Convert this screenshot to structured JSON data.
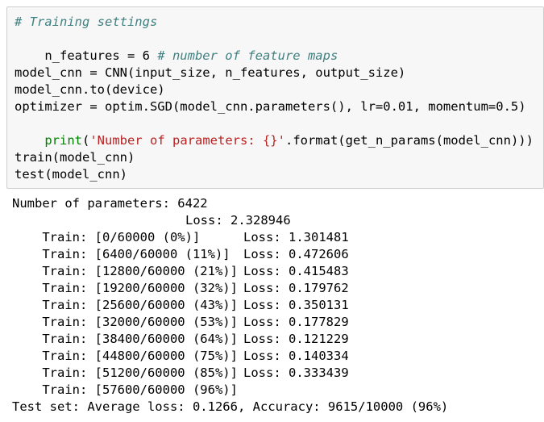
{
  "code": {
    "line1": "# Training settings",
    "line2a": "n_features = 6 ",
    "line2b": "# number of feature maps",
    "line4": "model_cnn = CNN(input_size, n_features, output_size)",
    "line5": "model_cnn.to(device)",
    "line6": "optimizer = optim.SGD(model_cnn.parameters(), lr=0.01, momentum=0.5)",
    "line7a": "print",
    "line7b": "(",
    "line7c": "'Number of parameters: {}'",
    "line7d": ".format(get_n_params(model_cnn)))",
    "line9": "train(model_cnn)",
    "line10": "test(model_cnn)"
  },
  "output": {
    "params": "Number of parameters: 6422",
    "train_rows": [
      {
        "left": "Train: [0/60000 (0%)]",
        "loss": "Loss: 2.328946"
      },
      {
        "left": "Train: [6400/60000 (11%)]",
        "loss": "Loss: 1.301481"
      },
      {
        "left": "Train: [12800/60000 (21%)]",
        "loss": "Loss: 0.472606"
      },
      {
        "left": "Train: [19200/60000 (32%)]",
        "loss": "Loss: 0.415483"
      },
      {
        "left": "Train: [25600/60000 (43%)]",
        "loss": "Loss: 0.179762"
      },
      {
        "left": "Train: [32000/60000 (53%)]",
        "loss": "Loss: 0.350131"
      },
      {
        "left": "Train: [38400/60000 (64%)]",
        "loss": "Loss: 0.177829"
      },
      {
        "left": "Train: [44800/60000 (75%)]",
        "loss": "Loss: 0.121229"
      },
      {
        "left": "Train: [51200/60000 (85%)]",
        "loss": "Loss: 0.140334"
      },
      {
        "left": "Train: [57600/60000 (96%)]",
        "loss": "Loss: 0.333439"
      }
    ],
    "test_result": "Test set: Average loss: 0.1266, Accuracy: 9615/10000 (96%)"
  },
  "colors": {
    "comment": "#408080",
    "builtin": "#008000",
    "string": "#ba2121",
    "cell_background": "#f7f7f7",
    "cell_border": "#cfcfcf"
  }
}
